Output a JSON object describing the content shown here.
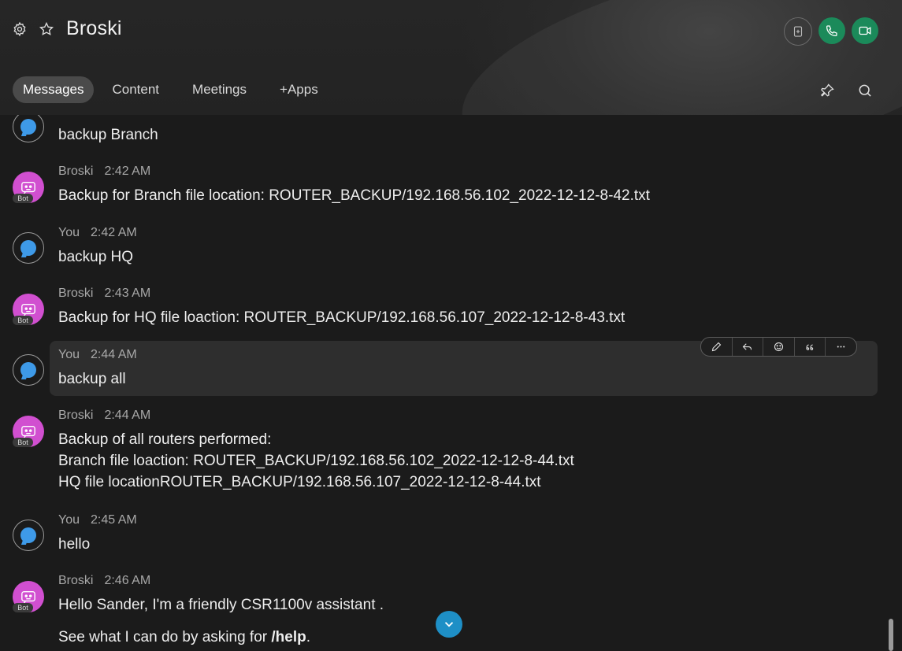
{
  "header": {
    "title": "Broski",
    "icons": {
      "settings": "gear-icon",
      "favorite": "star-icon"
    },
    "actions": {
      "add": "add-to-space-icon",
      "call": "phone-icon",
      "video": "video-icon"
    },
    "accent_green": "#1b8a5a"
  },
  "tabs": [
    {
      "label": "Messages",
      "active": true
    },
    {
      "label": "Content"
    },
    {
      "label": "Meetings"
    },
    {
      "label": "+Apps"
    }
  ],
  "tools": {
    "pin": "pin-icon",
    "search": "search-icon"
  },
  "messages": [
    {
      "sender": "",
      "time": "",
      "lines": [
        "backup Branch"
      ],
      "avatar": "user"
    },
    {
      "sender": "Broski",
      "time": "2:42 AM",
      "lines": [
        "Backup for Branch file location: ROUTER_BACKUP/192.168.56.102_2022-12-12-8-42.txt"
      ],
      "avatar": "bot",
      "badge": "Bot"
    },
    {
      "sender": "You",
      "time": "2:42 AM",
      "lines": [
        "backup HQ"
      ],
      "avatar": "user"
    },
    {
      "sender": "Broski",
      "time": "2:43 AM",
      "lines": [
        "Backup for HQ file loaction: ROUTER_BACKUP/192.168.56.107_2022-12-12-8-43.txt"
      ],
      "avatar": "bot",
      "badge": "Bot"
    },
    {
      "sender": "You",
      "time": "2:44 AM",
      "lines": [
        "backup all"
      ],
      "avatar": "user"
    },
    {
      "sender": "Broski",
      "time": "2:44 AM",
      "lines": [
        "Backup of all routers performed:",
        "Branch file loaction: ROUTER_BACKUP/192.168.56.102_2022-12-12-8-44.txt",
        "HQ file locationROUTER_BACKUP/192.168.56.107_2022-12-12-8-44.txt"
      ],
      "avatar": "bot",
      "badge": "Bot"
    },
    {
      "sender": "You",
      "time": "2:45 AM",
      "lines": [
        "hello"
      ],
      "avatar": "user"
    },
    {
      "sender": "Broski",
      "time": "2:46 AM",
      "lines": [
        "Hello Sander, I'm a friendly CSR1100v assistant ."
      ],
      "avatar": "bot",
      "badge": "Bot",
      "extra": {
        "prefix": "See what I can do by asking for ",
        "bold": "/help",
        "suffix": "."
      }
    }
  ],
  "hover_toolbar": [
    "edit-icon",
    "reply-icon",
    "react-icon",
    "quote-icon",
    "more-icon"
  ],
  "scroll_button": "chevron-down-icon",
  "colors": {
    "bot_avatar": "#d14fd0",
    "user_bubble": "#3e9ae8",
    "scroll_btn": "#1e8fc6"
  }
}
